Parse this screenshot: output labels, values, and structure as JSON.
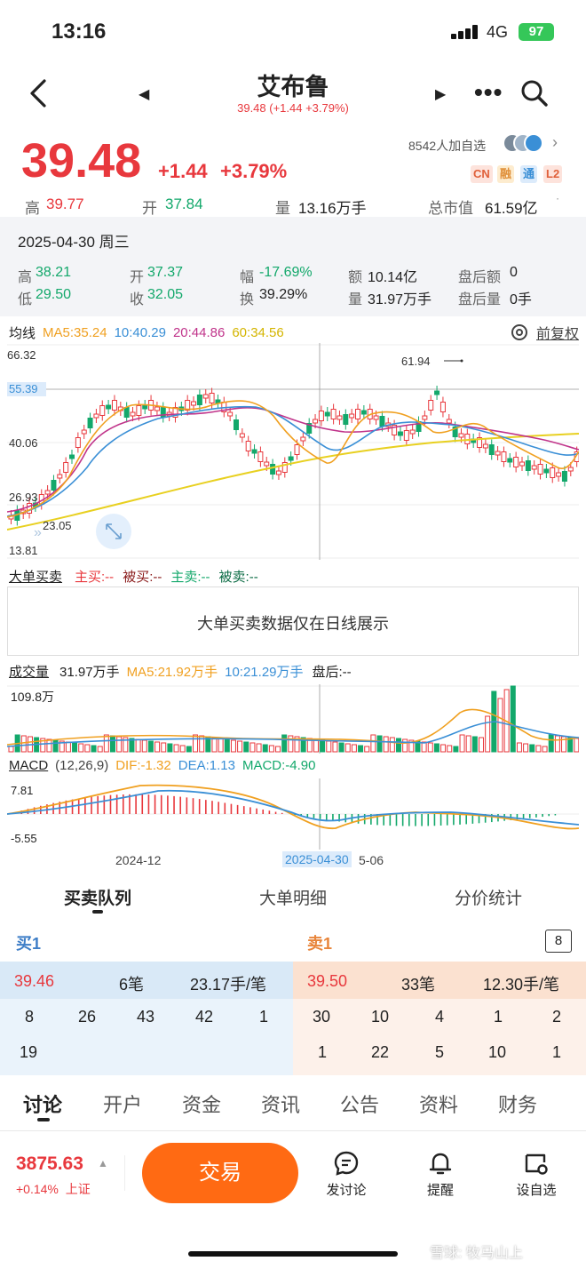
{
  "status": {
    "time": "13:16",
    "network": "4G",
    "battery": "97"
  },
  "header": {
    "title": "艾布鲁",
    "subquote": "39.48 (+1.44 +3.79%)"
  },
  "quote": {
    "price": "39.48",
    "change": "+1.44",
    "change_pct": "+3.79%",
    "watchers": "8542人加自选",
    "tags": [
      "CN",
      "融",
      "通",
      "L2"
    ],
    "high_label": "高",
    "high": "39.77",
    "open_label": "开",
    "open": "37.84",
    "volume_label": "量",
    "volume": "13.16万手",
    "mcap_label": "总市值",
    "mcap": "61.59亿"
  },
  "history": {
    "date": "2025-04-30 周三",
    "high_label": "高",
    "high": "38.21",
    "low_label": "低",
    "low": "29.50",
    "open_label": "开",
    "open": "37.37",
    "close_label": "收",
    "close": "32.05",
    "amp_label": "幅",
    "amp": "-17.69%",
    "turn_label": "换",
    "turn": "39.29%",
    "amount_label": "额",
    "amount": "10.14亿",
    "vol_label": "量",
    "vol": "31.97万手",
    "after_amount_label": "盘后额",
    "after_amount": "0",
    "after_vol_label": "盘后量",
    "after_vol": "0手"
  },
  "kline": {
    "ma_title": "均线",
    "ma5": "MA5:35.24",
    "ma10": "10:40.29",
    "ma20": "20:44.86",
    "ma60": "60:34.56",
    "adjust": "前复权",
    "y_labels": [
      "66.32",
      "55.39",
      "40.06",
      "26.93",
      "23.05",
      "13.81"
    ],
    "peak_label": "61.94"
  },
  "bigorder": {
    "title": "大单买卖",
    "main_buy": "主买:--",
    "passive_buy": "被买:--",
    "main_sell": "主卖:--",
    "passive_sell": "被卖:--",
    "message": "大单买卖数据仅在日线展示"
  },
  "volume": {
    "title": "成交量",
    "value": "31.97万手",
    "ma5": "MA5:21.92万手",
    "ma10": "10:21.29万手",
    "after": "盘后:--",
    "max": "109.8万"
  },
  "macd": {
    "title": "MACD",
    "params": "(12,26,9)",
    "dif": "DIF:-1.32",
    "dea": "DEA:1.13",
    "macd": "MACD:-4.90",
    "high": "7.81",
    "low": "-5.55"
  },
  "dates": {
    "d1": "2024-12",
    "selected": "2025-04-30",
    "d3": "5-06"
  },
  "orderbook": {
    "tabs": [
      "买卖队列",
      "大单明细",
      "分价统计"
    ],
    "buy_title": "买1",
    "sell_title": "卖1",
    "count_badge": "8",
    "buy_price": "39.46",
    "buy_orders": "6笔",
    "buy_avg": "23.17手/笔",
    "sell_price": "39.50",
    "sell_orders": "33笔",
    "sell_avg": "12.30手/笔",
    "buy_row1": [
      "8",
      "26",
      "43",
      "42",
      "1"
    ],
    "buy_row2": [
      "19"
    ],
    "sell_row1": [
      "30",
      "10",
      "4",
      "1",
      "2"
    ],
    "sell_row2": [
      "1",
      "22",
      "5",
      "10",
      "1"
    ]
  },
  "bottom_tabs": [
    "讨论",
    "开户",
    "资金",
    "资讯",
    "公告",
    "资料",
    "财务"
  ],
  "footer": {
    "index_value": "3875.63",
    "index_change": "+0.14%",
    "index_name": "上证",
    "trade": "交易",
    "discuss": "发讨论",
    "remind": "提醒",
    "watch": "设自选"
  },
  "watermark": "雪球: 牧马山上",
  "colors": {
    "up": "#e8383d",
    "down": "#13a86b",
    "ma5": "#f0a020",
    "ma10": "#3a8fd6",
    "ma20": "#c0338a",
    "ma60": "#e8d020",
    "trade": "#ff6a13"
  }
}
